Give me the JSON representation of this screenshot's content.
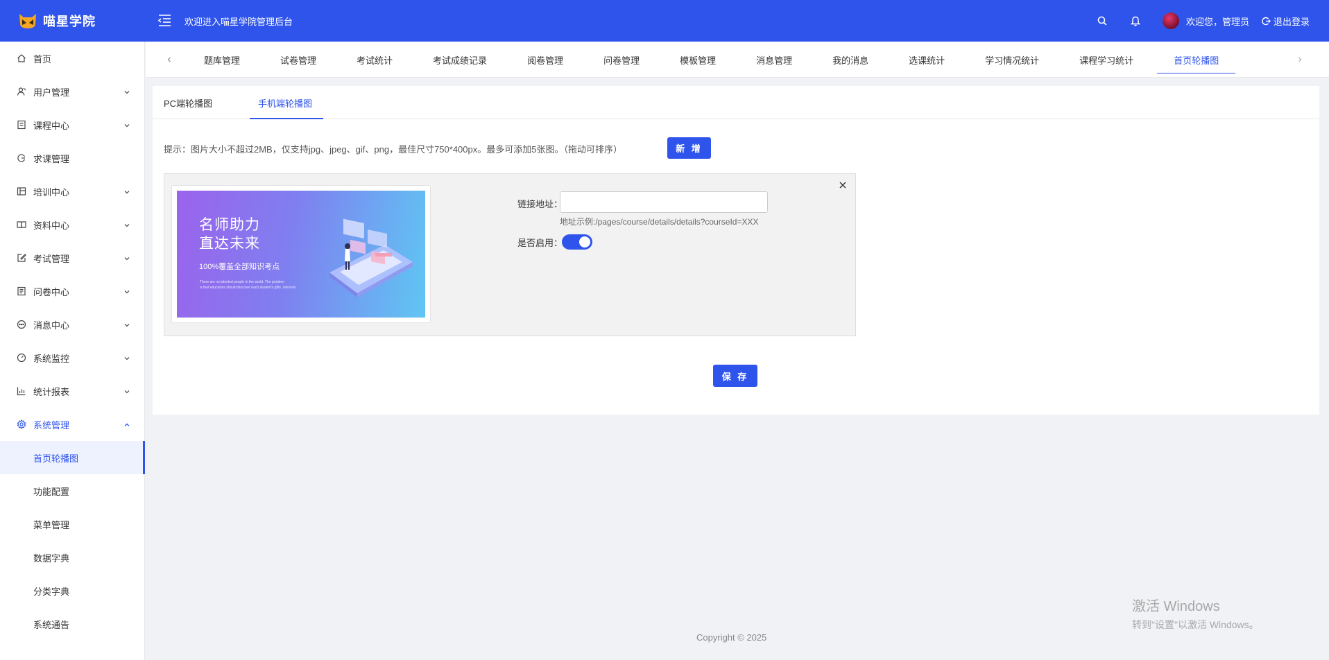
{
  "header": {
    "logo_text": "喵星学院",
    "welcome_title": "欢迎进入喵星学院管理后台",
    "greeting": "欢迎您，管理员",
    "logout_label": "退出登录",
    "brand_color": "#2f54eb"
  },
  "sidebar": {
    "items": [
      {
        "label": "首页",
        "icon": "home-icon"
      },
      {
        "label": "用户管理",
        "icon": "user-icon"
      },
      {
        "label": "课程中心",
        "icon": "course-icon"
      },
      {
        "label": "求课管理",
        "icon": "refresh-icon"
      },
      {
        "label": "培训中心",
        "icon": "training-icon"
      },
      {
        "label": "资料中心",
        "icon": "book-icon"
      },
      {
        "label": "考试管理",
        "icon": "edit-icon"
      },
      {
        "label": "问卷中心",
        "icon": "survey-icon"
      },
      {
        "label": "消息中心",
        "icon": "message-icon"
      },
      {
        "label": "系统监控",
        "icon": "dashboard-icon"
      },
      {
        "label": "统计报表",
        "icon": "chart-icon"
      },
      {
        "label": "系统管理",
        "icon": "gear-icon"
      }
    ],
    "subitems": [
      {
        "label": "首页轮播图"
      },
      {
        "label": "功能配置"
      },
      {
        "label": "菜单管理"
      },
      {
        "label": "数据字典"
      },
      {
        "label": "分类字典"
      },
      {
        "label": "系统通告"
      }
    ]
  },
  "tabs": [
    {
      "label": "题库管理"
    },
    {
      "label": "试卷管理"
    },
    {
      "label": "考试统计"
    },
    {
      "label": "考试成绩记录"
    },
    {
      "label": "阅卷管理"
    },
    {
      "label": "问卷管理"
    },
    {
      "label": "模板管理"
    },
    {
      "label": "消息管理"
    },
    {
      "label": "我的消息"
    },
    {
      "label": "选课统计"
    },
    {
      "label": "学习情况统计"
    },
    {
      "label": "课程学习统计"
    },
    {
      "label": "首页轮播图"
    }
  ],
  "content": {
    "subtabs": [
      {
        "label": "PC端轮播图"
      },
      {
        "label": "手机端轮播图"
      }
    ],
    "hint": "提示：图片大小不超过2MB，仅支持jpg、jpeg、gif、png，最佳尺寸750*400px。最多可添加5张图。（拖动可排序）",
    "add_label": "新 增",
    "banner": {
      "title_line1": "名师助力",
      "title_line2": "直达未来",
      "subtitle": "100%覆盖全部知识考点",
      "small_line1": "There are no talented people in the world. The problem",
      "small_line2": "is that educators should discover each student's gifts. interests"
    },
    "link_label": "链接地址：",
    "link_value": "",
    "link_example": "地址示例:/pages/course/details/details?courseId=XXX",
    "enable_label": "是否启用：",
    "enabled": true,
    "save_label": "保 存"
  },
  "footer": {
    "copyright": "Copyright © 2025"
  },
  "watermark": {
    "line1": "激活 Windows",
    "line2": "转到\"设置\"以激活 Windows。"
  }
}
